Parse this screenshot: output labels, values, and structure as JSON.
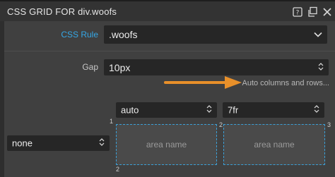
{
  "panel": {
    "title": "CSS GRID FOR div.woofs",
    "icons": [
      "help-icon",
      "undock-icon",
      "close-icon"
    ]
  },
  "css_rule": {
    "label": "CSS Rule",
    "value": ".woofs"
  },
  "gap": {
    "label": "Gap",
    "value": "10px"
  },
  "hint": "Auto columns and rows...",
  "columns": [
    {
      "value": "auto"
    },
    {
      "value": "7fr"
    }
  ],
  "rows": [
    {
      "value": "none"
    }
  ],
  "areas": [
    {
      "name": "area name"
    },
    {
      "name": "area name"
    }
  ],
  "line_numbers": {
    "top_left": "1",
    "mid_top": "2",
    "right_top": "3",
    "bottom_left": "2"
  },
  "colors": {
    "accent": "#35a7e6",
    "arrow": "#e8902a",
    "panel_bg": "#404040",
    "header_bg": "#333333"
  }
}
